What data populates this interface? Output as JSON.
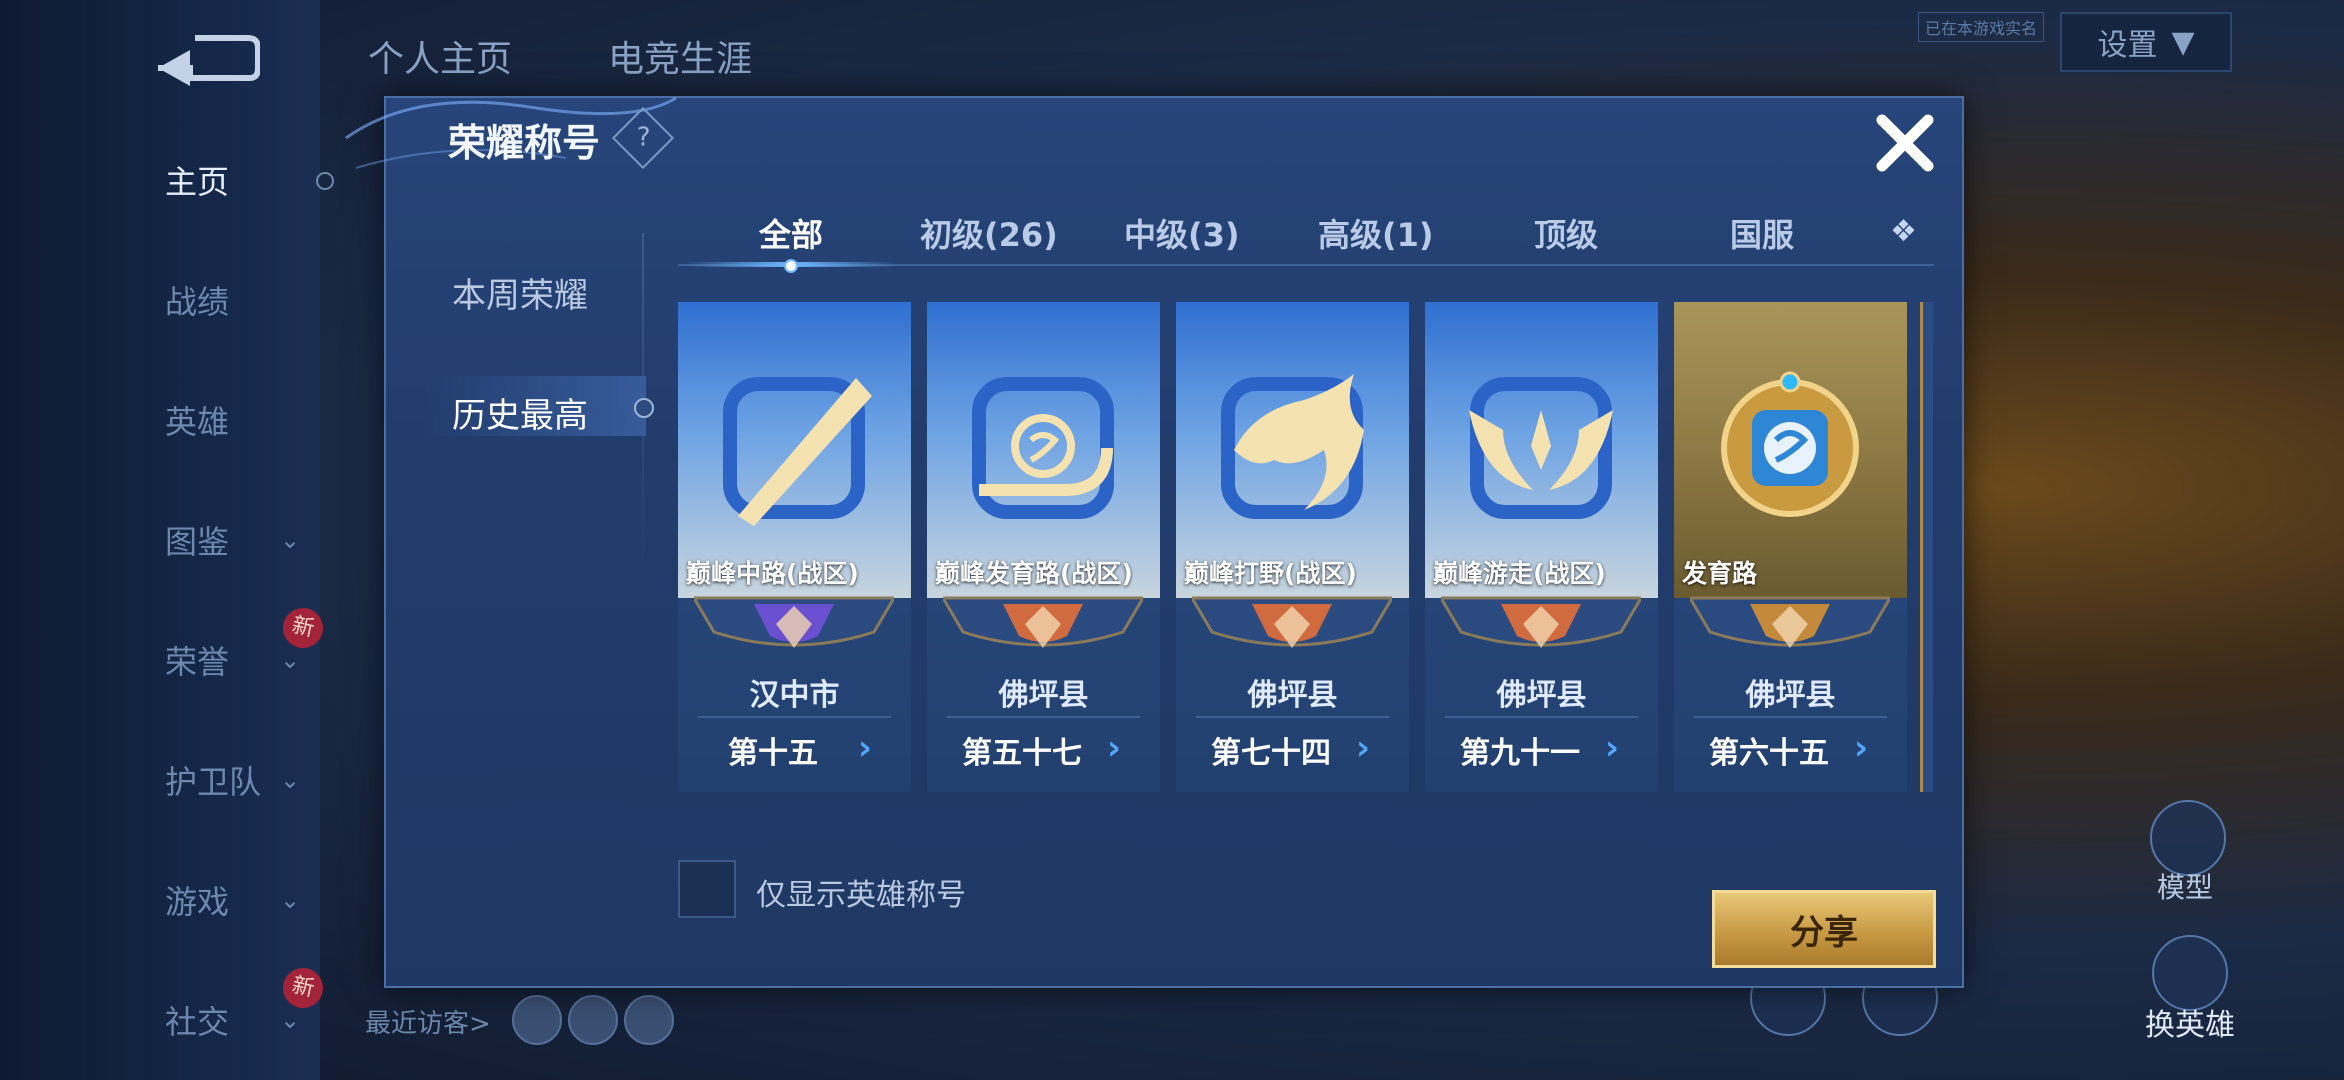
{
  "sidebar": {
    "items": [
      {
        "label": "主页",
        "chevron": false,
        "badge": ""
      },
      {
        "label": "战绩",
        "chevron": false,
        "badge": ""
      },
      {
        "label": "英雄",
        "chevron": false,
        "badge": ""
      },
      {
        "label": "图鉴",
        "chevron": true,
        "badge": ""
      },
      {
        "label": "荣誉",
        "chevron": true,
        "badge": "新"
      },
      {
        "label": "护卫队",
        "chevron": true,
        "badge": ""
      },
      {
        "label": "游戏",
        "chevron": true,
        "badge": ""
      },
      {
        "label": "社交",
        "chevron": true,
        "badge": "新"
      }
    ]
  },
  "top_nav": {
    "tabs": [
      "个人主页",
      "电竞生涯"
    ],
    "settings_label": "设置",
    "game_id_text": "已在本游戏实名"
  },
  "bottom_left": {
    "recent_visitors_label": "最近访客>"
  },
  "right_controls": {
    "model_label": "模型",
    "change_hero_label": "换英雄"
  },
  "modal": {
    "title": "荣耀称号",
    "help_glyph": "?",
    "left_menu": [
      "本周荣耀",
      "历史最高"
    ],
    "tabs": [
      "全部",
      "初级(26)",
      "中级(3)",
      "高级(1)",
      "顶级",
      "国服"
    ],
    "cards": [
      {
        "name": "巅峰中路(战区)",
        "region": "汉中市",
        "rank": "第十五",
        "banner_color": "#6a4fd0",
        "emblem": "slash-emblem-icon",
        "style": "blue"
      },
      {
        "name": "巅峰发育路(战区)",
        "region": "佛坪县",
        "rank": "第五十七",
        "banner_color": "#d06a3f",
        "emblem": "marksman-emblem-icon",
        "style": "blue"
      },
      {
        "name": "巅峰打野(战区)",
        "region": "佛坪县",
        "rank": "第七十四",
        "banner_color": "#d06a3f",
        "emblem": "dragon-emblem-icon",
        "style": "blue"
      },
      {
        "name": "巅峰游走(战区)",
        "region": "佛坪县",
        "rank": "第九十一",
        "banner_color": "#d06a3f",
        "emblem": "wings-emblem-icon",
        "style": "blue"
      },
      {
        "name": "发育路",
        "region": "佛坪县",
        "rank": "第六十五",
        "banner_color": "#c28a3a",
        "emblem": "gold-shield-emblem-icon",
        "style": "gold"
      }
    ],
    "checkbox_label": "仅显示英雄称号",
    "share_label": "分享"
  }
}
